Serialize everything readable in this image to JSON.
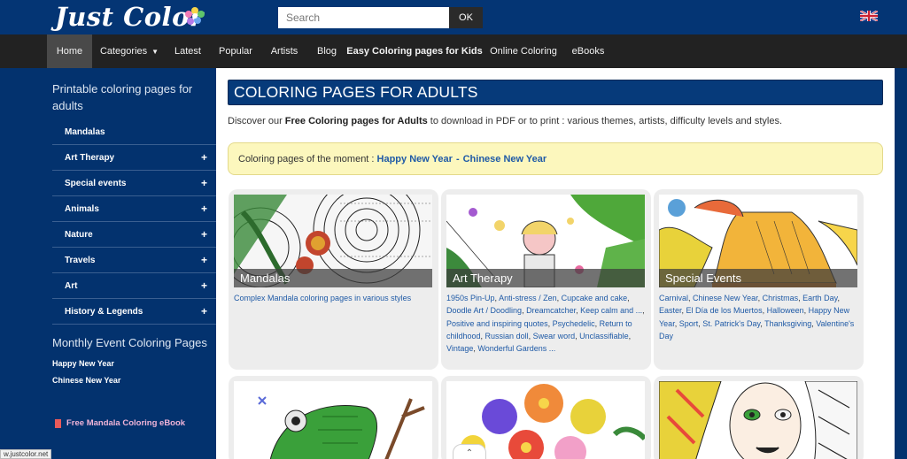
{
  "header": {
    "logo_text": "Just Color",
    "search_placeholder": "Search",
    "search_button": "OK",
    "flag_icon": "uk-flag-icon"
  },
  "nav": {
    "items": [
      {
        "label": "Home",
        "active": true
      },
      {
        "label": "Categories",
        "has_caret": true
      },
      {
        "label": "Latest"
      },
      {
        "label": "Popular"
      },
      {
        "label": "Artists"
      },
      {
        "label": "Blog"
      },
      {
        "label": "Easy Coloring pages for Kids",
        "bold": true
      },
      {
        "label": "Online Coloring"
      },
      {
        "label": "eBooks"
      }
    ]
  },
  "sidebar": {
    "title": "Printable coloring pages for adults",
    "items": [
      {
        "label": "Mandalas",
        "expandable": false
      },
      {
        "label": "Art Therapy",
        "expandable": true
      },
      {
        "label": "Special events",
        "expandable": true
      },
      {
        "label": "Animals",
        "expandable": true
      },
      {
        "label": "Nature",
        "expandable": true
      },
      {
        "label": "Travels",
        "expandable": true
      },
      {
        "label": "Art",
        "expandable": true
      },
      {
        "label": "History & Legends",
        "expandable": true
      }
    ],
    "plus_symbol": "+",
    "monthly_title": "Monthly Event Coloring Pages",
    "events": [
      "Happy New Year",
      "Chinese New Year"
    ],
    "ebook_label": "Free Mandala Coloring eBook",
    "status_url": "w.justcolor.net"
  },
  "main": {
    "title": "COLORING PAGES FOR ADULTS",
    "intro_prefix": "Discover our ",
    "intro_bold": "Free Coloring pages for Adults",
    "intro_suffix": " to download in PDF or to print : various themes, artists, difficulty levels and styles.",
    "moment_prefix": "Coloring pages of the moment : ",
    "moment_links": [
      "Happy New Year",
      "Chinese New Year"
    ],
    "moment_sep": "-",
    "cards": [
      {
        "label": "Mandalas",
        "links": [
          "Complex Mandala coloring pages in various styles"
        ]
      },
      {
        "label": "Art Therapy",
        "links": [
          "1950s Pin-Up",
          "Anti-stress / Zen",
          "Cupcake and cake",
          "Doodle Art / Doodling",
          "Dreamcatcher",
          "Keep calm and ...",
          "Positive and inspiring quotes",
          "Psychedelic",
          "Return to childhood",
          "Russian doll",
          "Swear word",
          "Unclassifiable",
          "Vintage",
          "Wonderful Gardens ..."
        ]
      },
      {
        "label": "Special Events",
        "links": [
          "Carnival",
          "Chinese New Year",
          "Christmas",
          "Earth Day",
          "Easter",
          "El Día de los Muertos",
          "Halloween",
          "Happy New Year",
          "Sport",
          "St. Patrick's Day",
          "Thanksgiving",
          "Valentine's Day"
        ]
      },
      {
        "label": "",
        "links": []
      },
      {
        "label": "",
        "links": []
      },
      {
        "label": "",
        "links": []
      }
    ],
    "scroll_icon": "chevron-up-icon"
  }
}
